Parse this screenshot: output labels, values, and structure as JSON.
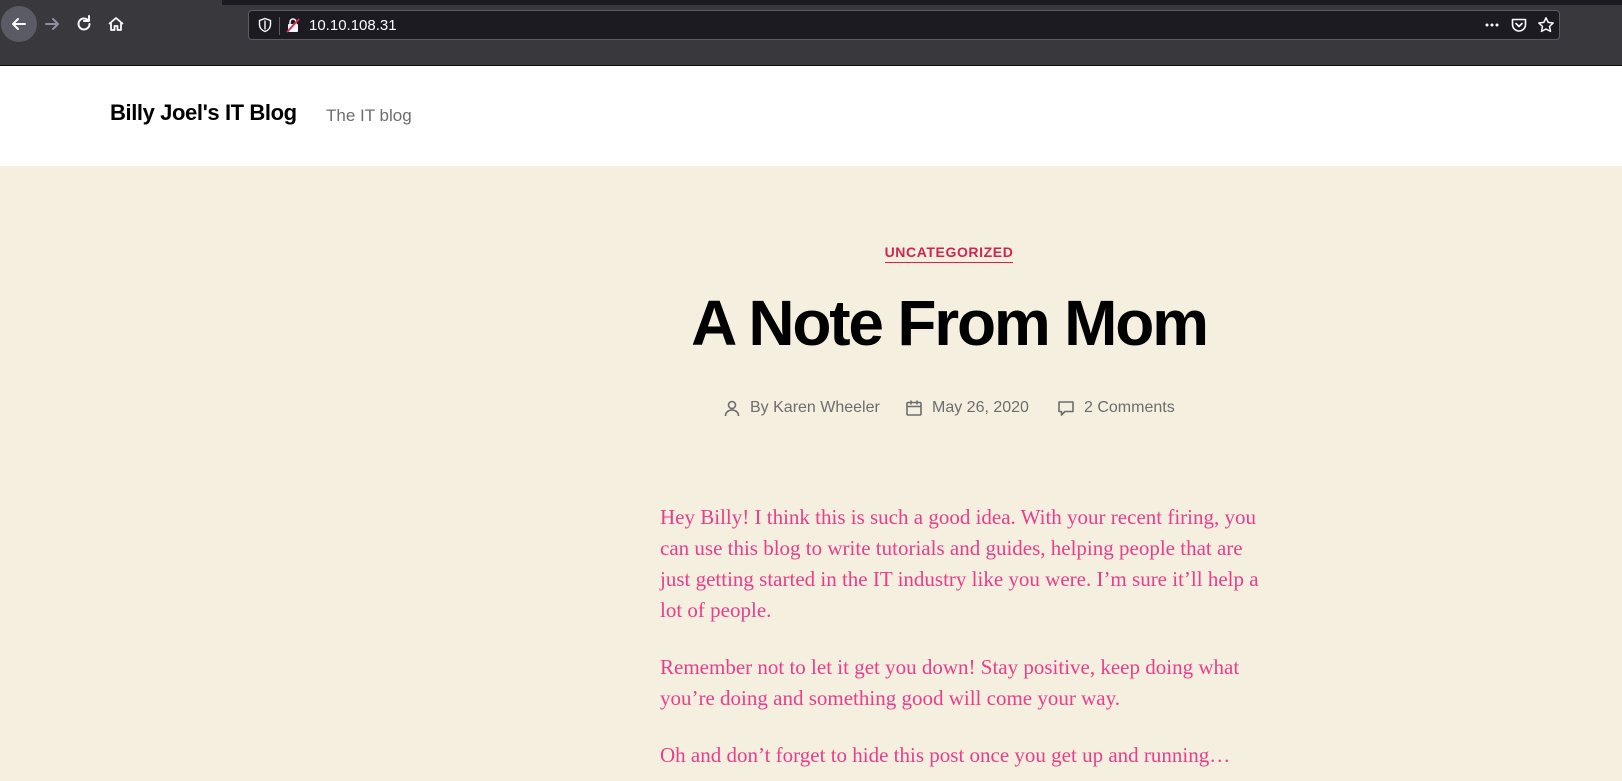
{
  "browser": {
    "url": "10.10.108.31",
    "icons": [
      "back-icon",
      "forward-icon",
      "reload-icon",
      "home-icon",
      "tracking-shield-icon",
      "insecure-lock-icon",
      "more-icon",
      "pocket-icon",
      "bookmark-star-icon"
    ]
  },
  "site": {
    "title": "Billy Joel's IT Blog",
    "description": "The IT blog"
  },
  "post": {
    "category": "UNCATEGORIZED",
    "title": "A Note From Mom",
    "author": "By Karen Wheeler",
    "date": "May 26, 2020",
    "comments": "2 Comments",
    "paragraphs": [
      "Hey Billy!  I think this is such a good idea.  With your recent firing, you can use this blog to write tutorials and guides, helping people that are just getting started in the IT industry like you were.  I’m sure it’ll help a lot of people.",
      "Remember not to let it get you down!  Stay positive, keep doing what you’re doing and something good will come your way.",
      "Oh and don’t forget to hide this post once you get up and running…"
    ]
  },
  "colors": {
    "chrome": "#38383d",
    "page_background": "#f5efe0",
    "accent": "#cd2653",
    "content_text": "#e83e8c"
  }
}
